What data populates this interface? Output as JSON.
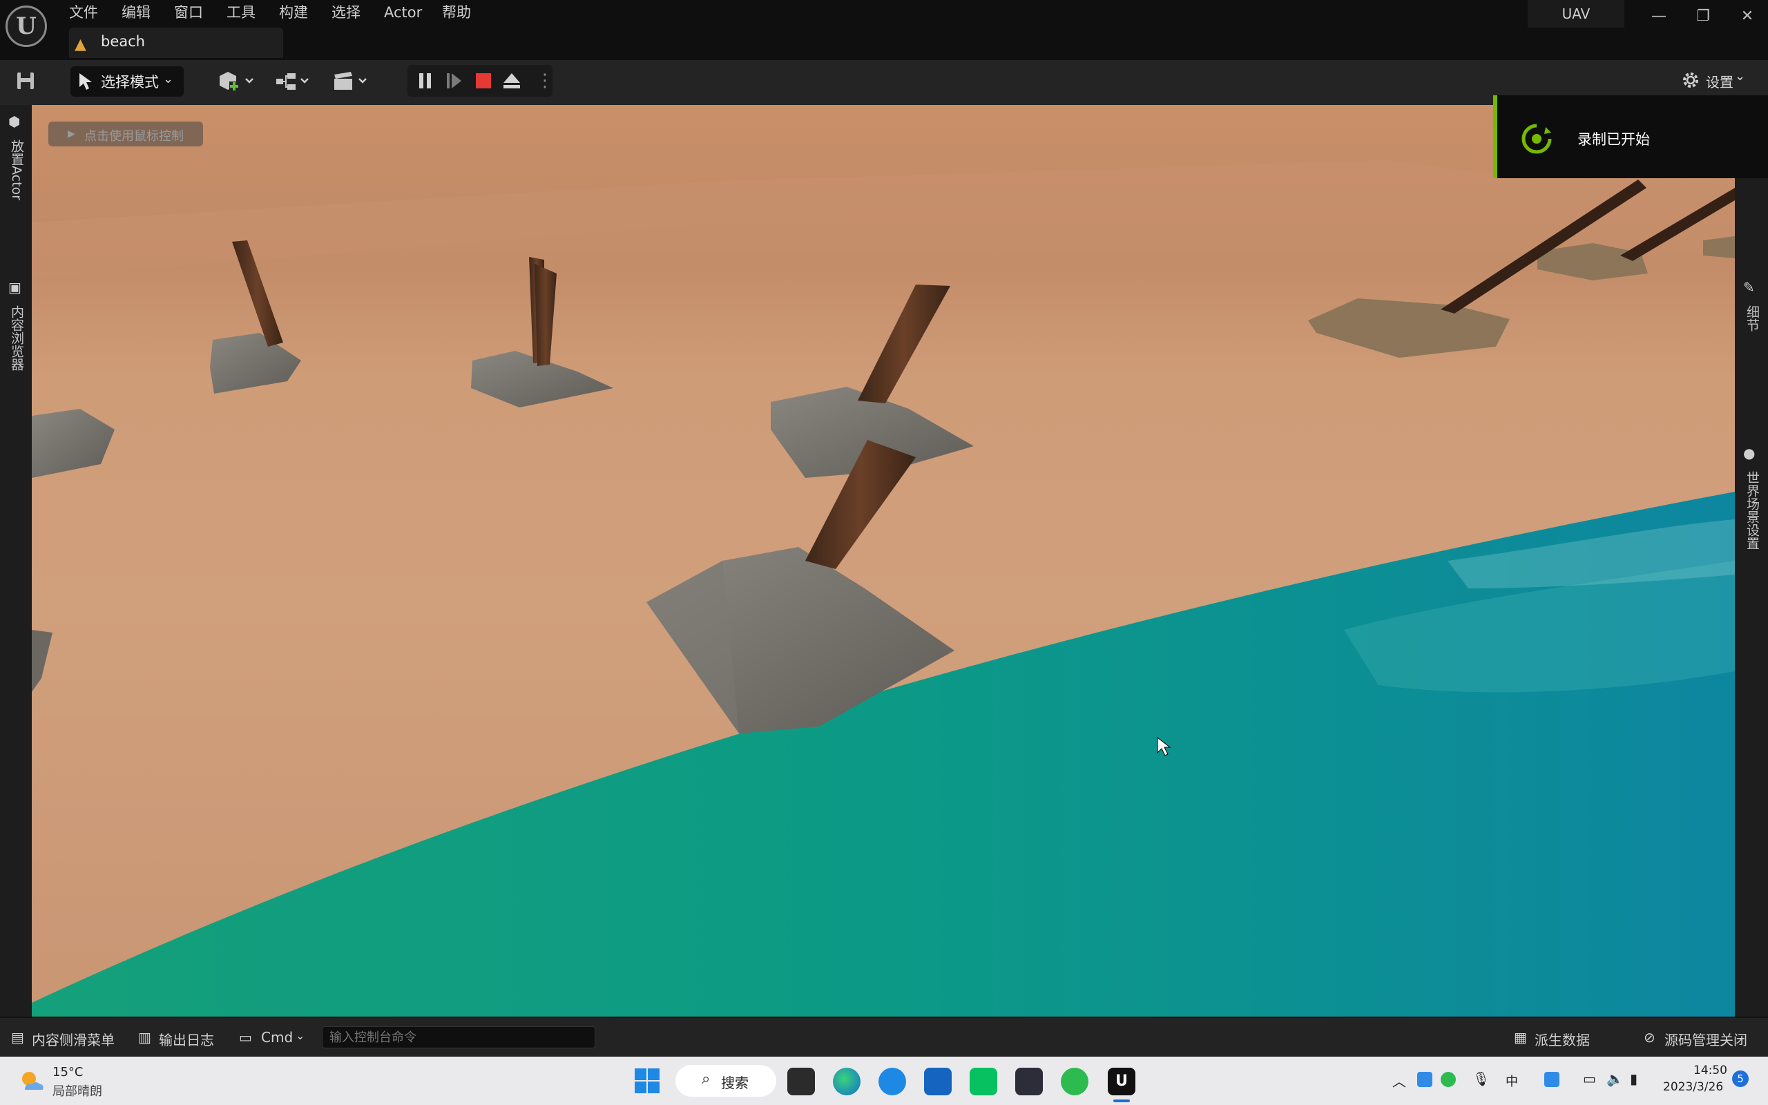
{
  "menu": [
    "文件",
    "编辑",
    "窗口",
    "工具",
    "构建",
    "选择",
    "Actor",
    "帮助"
  ],
  "level_tab": {
    "label": "beach"
  },
  "project_name": "UAV",
  "window_controls": {
    "minimize": "—",
    "restore": "❐",
    "close": "✕"
  },
  "toolbar": {
    "mode_label": "选择模式",
    "settings_label": "设置"
  },
  "left_panel": {
    "place_actor": "放置Actor",
    "content_browser": "内容浏览器"
  },
  "right_panel": {
    "details": "细节",
    "world_settings": "世界场景设置"
  },
  "viewport": {
    "hint": "点击使用鼠标控制"
  },
  "toast": {
    "text": "录制已开始"
  },
  "bottom_bar": {
    "content_drawer": "内容侧滑菜单",
    "output_log": "输出日志",
    "cmd_label": "Cmd",
    "cmd_placeholder": "输入控制台命令",
    "derived_data": "派生数据",
    "source_control": "源码管理关闭"
  },
  "taskbar": {
    "weather_temp": "15°C",
    "weather_desc": "局部晴朗",
    "search_label": "搜索",
    "time": "14:50",
    "date": "2023/3/26",
    "notification_count": "5"
  },
  "colors": {
    "accent_nvidia": "#76b900",
    "record_red": "#e53935",
    "water": "#0e9a86",
    "sand": "#cc9a77"
  }
}
